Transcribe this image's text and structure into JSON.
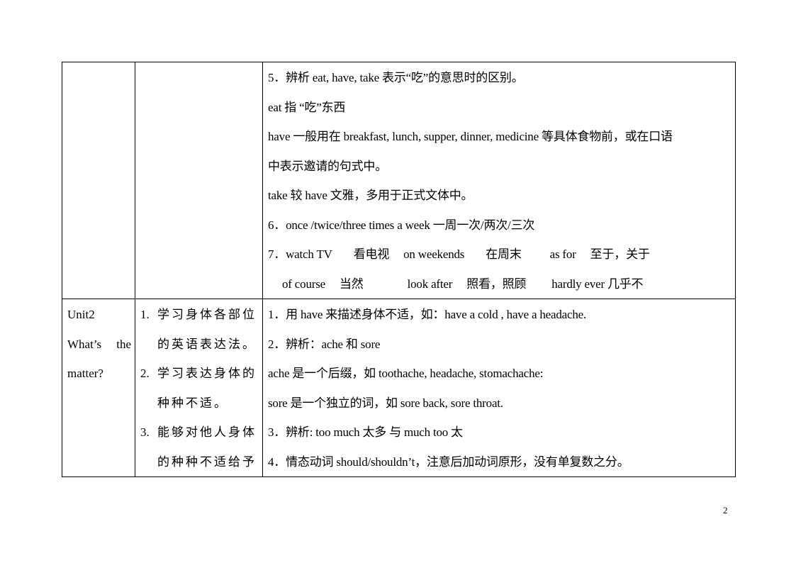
{
  "document": {
    "page_number": "2",
    "table": {
      "row1": {
        "unit_lines": [],
        "objectives": [],
        "content_lines": [
          "5．辨析 eat, have, take  表示“吃”的意思时的区别。",
          "eat 指  “吃”东西",
          "have 一般用在 breakfast, lunch, supper, dinner, medicine  等具体食物前，或在口语",
          "中表示邀请的句式中。",
          "take 较 have 文雅，多用于正式文体中。",
          "6．once /twice/three times a week  一周一次/两次/三次"
        ],
        "phrase_line_7": {
          "prefix": "7．",
          "pairs": [
            {
              "en": "watch TV",
              "zh": "看电视"
            },
            {
              "en": "on weekends",
              "zh": "在周末"
            },
            {
              "en": "as for",
              "zh": "至于，关于"
            }
          ]
        },
        "phrase_line_8": {
          "pairs": [
            {
              "en": "of course",
              "zh": "当然"
            },
            {
              "en": "look after",
              "zh": "照看，照顾"
            },
            {
              "en": "hardly ever",
              "zh": "几乎不"
            }
          ]
        }
      },
      "row2": {
        "unit": {
          "line1": "Unit2",
          "line2_a": "What’s",
          "line2_b": "the",
          "line3": "matter?"
        },
        "objectives": [
          {
            "num": "1.",
            "lines": [
              "学习身体各部位",
              "的英语表达法。"
            ]
          },
          {
            "num": "2.",
            "lines": [
              "学习表达身体的",
              "种种不适。"
            ]
          },
          {
            "num": "3.",
            "lines": [
              "能够对他人身体",
              "的种种不适给予"
            ]
          }
        ],
        "content_lines": [
          "1．用 have 来描述身体不适，如：have a cold , have a headache.",
          "2．辨析：ache  和  sore",
          "ache 是一个后缀，如 toothache, headache, stomachache:",
          "sore  是一个独立的词，如 sore back, sore throat.",
          "3．辨析: too much    太多    与    much    too  太",
          "4．情态动词 should/shouldn’t，注意后加动词原形，没有单复数之分。"
        ]
      }
    }
  }
}
